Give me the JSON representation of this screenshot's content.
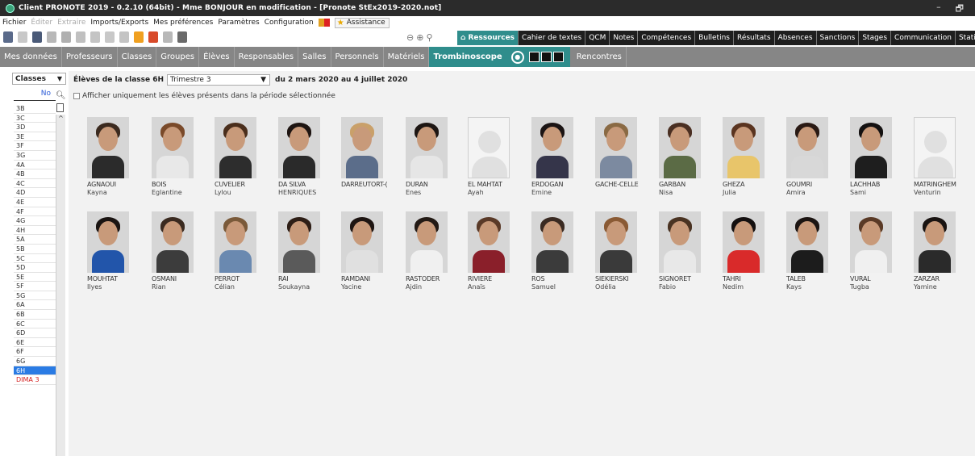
{
  "titlebar": {
    "title": "Client PRONOTE 2019 - 0.2.10 (64bit) - Mme BONJOUR en modification - [Pronote StEx2019-2020.not]",
    "min": "–",
    "max": "🗗"
  },
  "menu": {
    "items": [
      "Fichier",
      "Éditer",
      "Extraire",
      "Imports/Exports",
      "Mes préférences",
      "Paramètres",
      "Configuration"
    ],
    "disabled": [
      1,
      2
    ],
    "assistance": "Assistance"
  },
  "tabs": [
    "Ressources",
    "Cahier de textes",
    "QCM",
    "Notes",
    "Compétences",
    "Bulletins",
    "Résultats",
    "Absences",
    "Sanctions",
    "Stages",
    "Communication",
    "Statistiques"
  ],
  "subnav": {
    "items": [
      "Mes données",
      "Professeurs",
      "Classes",
      "Groupes",
      "Élèves",
      "Responsables",
      "Salles",
      "Personnels",
      "Matériels"
    ],
    "active": "Trombinoscope",
    "after": "Rencontres"
  },
  "left": {
    "select_label": "Classes",
    "list_header": "No",
    "classes": [
      "3B",
      "3C",
      "3D",
      "3E",
      "3F",
      "3G",
      "4A",
      "4B",
      "4C",
      "4D",
      "4E",
      "4F",
      "4G",
      "4H",
      "5A",
      "5B",
      "5C",
      "5D",
      "5E",
      "5F",
      "5G",
      "6A",
      "6B",
      "6C",
      "6D",
      "6E",
      "6F",
      "6G",
      "6H",
      "DIMA 3"
    ],
    "selected": "6H",
    "red": "DIMA 3"
  },
  "filters": {
    "label": "Élèves de la classe 6H",
    "period": "Trimestre 3",
    "dates": "du 2 mars 2020 au 4 juillet 2020",
    "checkbox_label": "Afficher uniquement les élèves présents dans la période sélectionnée"
  },
  "students": [
    {
      "last": "AGNAOUI",
      "first": "Kayna",
      "hair": "#3b2a1f",
      "shirt": "#2b2b2b"
    },
    {
      "last": "BOIS",
      "first": "Eglantine",
      "hair": "#7a4a2a",
      "shirt": "#e8e8e8"
    },
    {
      "last": "CUVELIER",
      "first": "Lylou",
      "hair": "#4a2e1c",
      "shirt": "#2d2d2d"
    },
    {
      "last": "DA SILVA HENRIQUES",
      "first": "",
      "hair": "#1e1512",
      "shirt": "#2a2a2a"
    },
    {
      "last": "DARREUTORT-(",
      "first": "",
      "hair": "#c9a06a",
      "shirt": "#5b6d8a"
    },
    {
      "last": "DURAN",
      "first": "Enes",
      "hair": "#1d1613",
      "shirt": "#e6e6e6"
    },
    {
      "last": "EL MAHTAT",
      "first": "Ayah",
      "photo": "none"
    },
    {
      "last": "ERDOGAN",
      "first": "Emine",
      "hair": "#1b1414",
      "shirt": "#35354a"
    },
    {
      "last": "GACHE-CELLE",
      "first": "",
      "hair": "#8a6a44",
      "shirt": "#7c8aa0"
    },
    {
      "last": "GARBAN",
      "first": "Nisa",
      "hair": "#4a2f22",
      "shirt": "#5b6b45"
    },
    {
      "last": "GHEZA",
      "first": "Julia",
      "hair": "#5a3420",
      "shirt": "#e8c56a"
    },
    {
      "last": "GOUMRI",
      "first": "Amira",
      "hair": "#2a1a14",
      "shirt": "#d8d8d8"
    },
    {
      "last": "LACHHAB",
      "first": "Sami",
      "hair": "#141111",
      "shirt": "#1e1e1e"
    },
    {
      "last": "MATRINGHEM",
      "first": "Venturin",
      "photo": "none"
    },
    {
      "last": "MOUHTAT",
      "first": "Ilyes",
      "hair": "#1a1412",
      "shirt": "#2255aa"
    },
    {
      "last": "OSMANI",
      "first": "Rian",
      "hair": "#3a2a20",
      "shirt": "#3c3c3c"
    },
    {
      "last": "PERROT",
      "first": "Célian",
      "hair": "#7a5a3a",
      "shirt": "#6a89b0"
    },
    {
      "last": "RAI",
      "first": "Soukayna",
      "hair": "#2e1e16",
      "shirt": "#5a5a5a"
    },
    {
      "last": "RAMDANI",
      "first": "Yacine",
      "hair": "#1e1512",
      "shirt": "#e0e0e0"
    },
    {
      "last": "RASTODER",
      "first": "Ajdin",
      "hair": "#231a15",
      "shirt": "#f0f0f0"
    },
    {
      "last": "RIVIERE",
      "first": "Anaïs",
      "hair": "#5a3a28",
      "shirt": "#8a1f2a"
    },
    {
      "last": "ROS",
      "first": "Samuel",
      "hair": "#3a2a22",
      "shirt": "#3b3b3b"
    },
    {
      "last": "SIEKIERSKI",
      "first": "Odélia",
      "hair": "#8a5a34",
      "shirt": "#3a3a3a"
    },
    {
      "last": "SIGNORET",
      "first": "Fabio",
      "hair": "#4a3322",
      "shirt": "#e8e8e8"
    },
    {
      "last": "TAHRI",
      "first": "Nedim",
      "hair": "#141010",
      "shirt": "#d92a2a"
    },
    {
      "last": "TALEB",
      "first": "Kays",
      "hair": "#1c1512",
      "shirt": "#1c1c1c"
    },
    {
      "last": "VURAL",
      "first": "Tugba",
      "hair": "#5a3a26",
      "shirt": "#f0f0f0"
    },
    {
      "last": "ZARZAR",
      "first": "Yamine",
      "hair": "#1a1412",
      "shirt": "#2a2a2a"
    }
  ],
  "extra_lines": {
    "3": "HENRIQUES"
  },
  "colors": {
    "accent": "#2f8d8c",
    "selection": "#2a7be4",
    "subnav": "#868686"
  }
}
